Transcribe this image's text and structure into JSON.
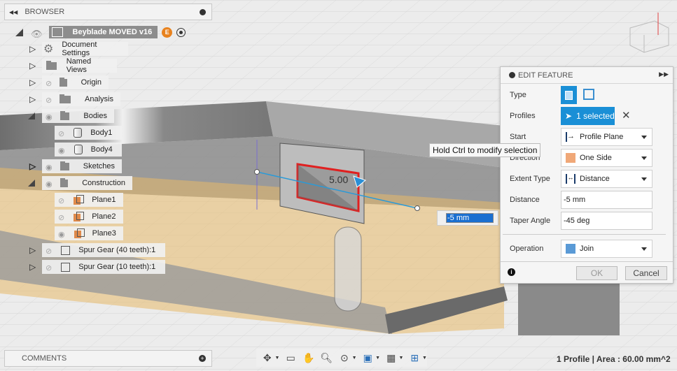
{
  "browser": {
    "title": "BROWSER",
    "root": {
      "label": "Beyblade MOVED v16",
      "badge": "E"
    },
    "items": [
      {
        "label": "Document Settings"
      },
      {
        "label": "Named Views"
      },
      {
        "label": "Origin"
      },
      {
        "label": "Analysis"
      },
      {
        "label": "Bodies"
      },
      {
        "label": "Body1"
      },
      {
        "label": "Body4"
      },
      {
        "label": "Sketches"
      },
      {
        "label": "Construction"
      },
      {
        "label": "Plane1"
      },
      {
        "label": "Plane2"
      },
      {
        "label": "Plane3"
      },
      {
        "label": "Spur Gear (40 teeth):1"
      },
      {
        "label": "Spur Gear (10 teeth):1"
      }
    ]
  },
  "comments": {
    "title": "COMMENTS"
  },
  "viewport": {
    "dimension_label": "5.00",
    "distance_input": "-5 mm",
    "tooltip": "Hold Ctrl to modify selection"
  },
  "edit_feature": {
    "title": "EDIT FEATURE",
    "type_label": "Type",
    "profiles_label": "Profiles",
    "profiles_value": "1 selected",
    "start_label": "Start",
    "start_value": "Profile Plane",
    "direction_label": "Direction",
    "direction_value": "One Side",
    "extent_label": "Extent Type",
    "extent_value": "Distance",
    "distance_label": "Distance",
    "distance_value": "-5 mm",
    "taper_label": "Taper Angle",
    "taper_value": "-45 deg",
    "operation_label": "Operation",
    "operation_value": "Join",
    "ok": "OK",
    "cancel": "Cancel"
  },
  "status": {
    "text": "1 Profile | Area : 60.00 mm^2"
  },
  "colors": {
    "accent": "#1a8fd6",
    "body": "#e8b96a",
    "profile_outline": "#e02020",
    "badge": "#e8821e"
  }
}
